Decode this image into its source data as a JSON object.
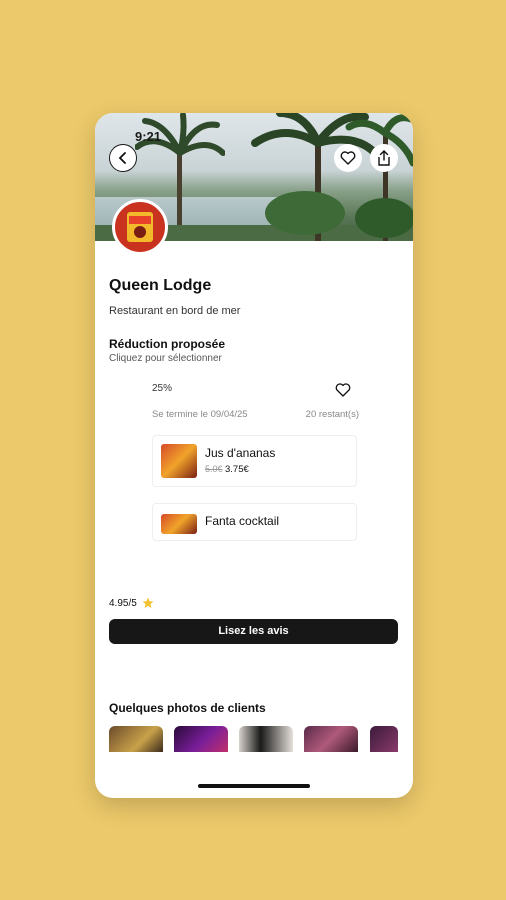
{
  "status": {
    "time": "9:21"
  },
  "restaurant": {
    "name": "Queen Lodge",
    "category": "Restaurant en bord de mer"
  },
  "discount_section": {
    "title": "Réduction proposée",
    "hint": "Cliquez pour sélectionner"
  },
  "offer": {
    "percent": "25%",
    "ends": "Se termine le 09/04/25",
    "remaining": "20 restant(s)",
    "items": [
      {
        "name": "Jus d'ananas",
        "old_price": "5.0€",
        "new_price": "3.75€"
      },
      {
        "name": "Fanta cocktail"
      }
    ]
  },
  "rating": {
    "value": "4.95/5",
    "star_color": "#F2C230"
  },
  "reviews_button": {
    "label": "Lisez les avis"
  },
  "photos": {
    "title": "Quelques photos de clients"
  },
  "icons": {
    "back": "chevron-left-icon",
    "favorite": "heart-icon",
    "share": "share-icon"
  }
}
